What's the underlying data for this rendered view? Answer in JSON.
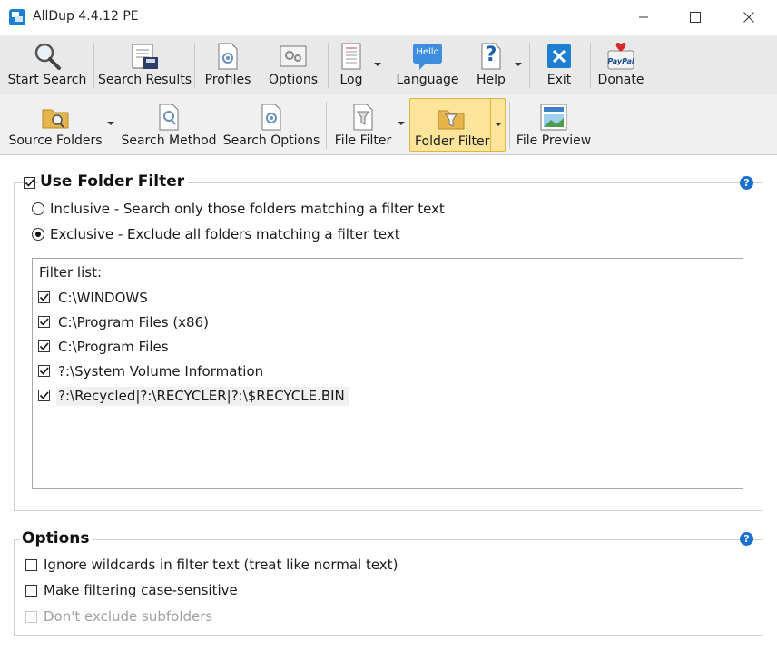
{
  "window": {
    "title": "AllDup 4.4.12 PE"
  },
  "toolbar_main": {
    "start_search": "Start Search",
    "search_results": "Search Results",
    "profiles": "Profiles",
    "options": "Options",
    "log": "Log",
    "language": "Language",
    "language_badge": "Hello",
    "help": "Help",
    "help_glyph": "?",
    "exit": "Exit",
    "donate": "Donate",
    "donate_badge": "PayPal"
  },
  "toolbar_sub": {
    "source_folders": "Source Folders",
    "search_method": "Search Method",
    "search_options": "Search Options",
    "file_filter": "File Filter",
    "folder_filter": "Folder Filter",
    "file_preview": "File Preview"
  },
  "folder_filter": {
    "title": "Use Folder Filter",
    "enabled": true,
    "inclusive_label": "Inclusive - Search only those folders matching a filter text",
    "exclusive_label": "Exclusive - Exclude all folders matching a filter text",
    "selected_mode": "exclusive",
    "filter_list_label": "Filter list:",
    "items": [
      {
        "text": "C:\\WINDOWS",
        "checked": true
      },
      {
        "text": "C:\\Program Files (x86)",
        "checked": true
      },
      {
        "text": "C:\\Program Files",
        "checked": true
      },
      {
        "text": "?:\\System Volume Information",
        "checked": true
      },
      {
        "text": "?:\\Recycled|?:\\RECYCLER|?:\\$RECYCLE.BIN",
        "checked": true,
        "selected": true
      }
    ]
  },
  "options": {
    "title": "Options",
    "ignore_wildcards": "Ignore wildcards in filter text (treat like normal text)",
    "case_sensitive": "Make filtering case-sensitive",
    "dont_exclude_subfolders": "Don't exclude subfolders"
  },
  "help_glyph": "?",
  "colors": {
    "accent": "#1a6fd1",
    "active_tab_bg": "#fce59a",
    "toolbar_bg": "#e9e9ea"
  }
}
